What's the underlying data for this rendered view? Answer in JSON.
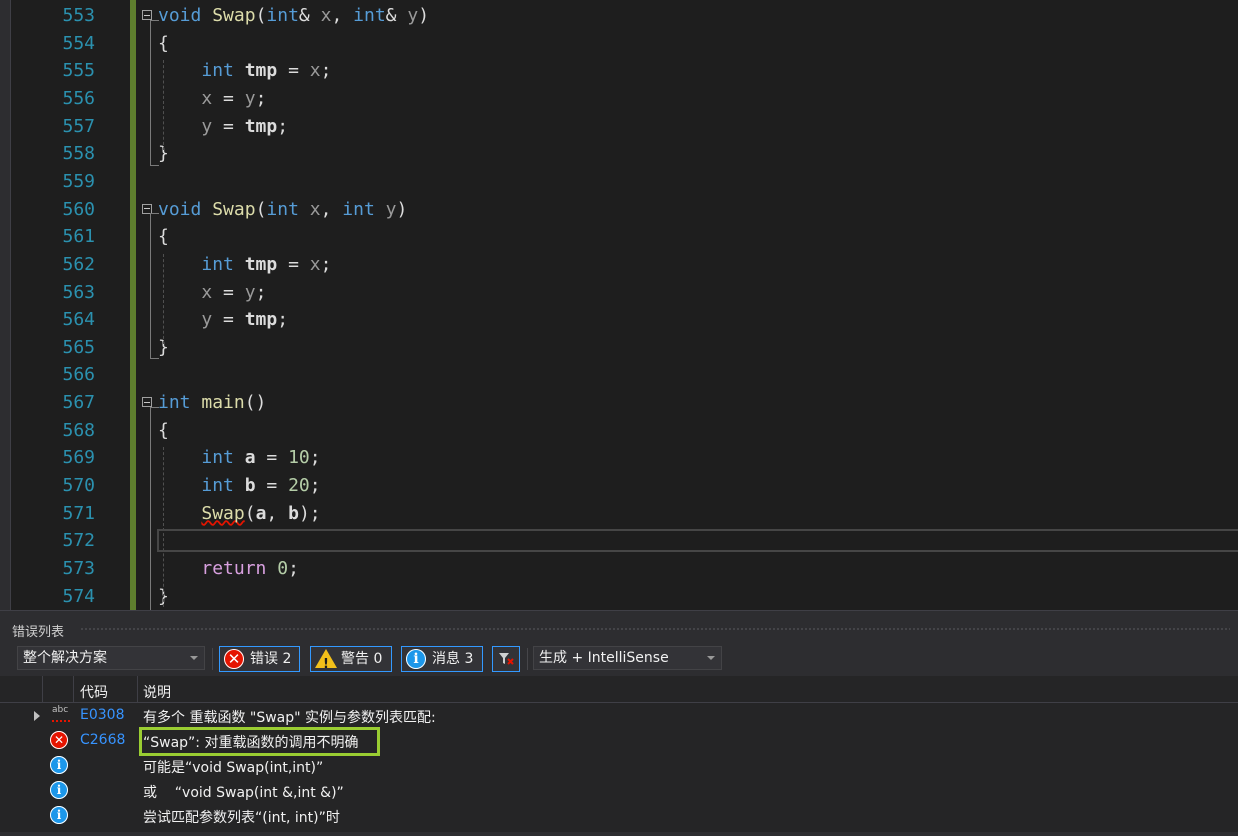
{
  "editor": {
    "lines": [
      {
        "n": "553",
        "fold": true,
        "parts": [
          [
            "k",
            "void"
          ],
          [
            "t",
            " "
          ],
          [
            "f",
            "Swap"
          ],
          [
            "t",
            "("
          ],
          [
            "k",
            "int"
          ],
          [
            "t",
            "& "
          ],
          [
            "p",
            "x"
          ],
          [
            "t",
            ", "
          ],
          [
            "k",
            "int"
          ],
          [
            "t",
            "& "
          ],
          [
            "p",
            "y"
          ],
          [
            "t",
            ")"
          ]
        ]
      },
      {
        "n": "554",
        "fold": false,
        "parts": [
          [
            "t",
            "{"
          ]
        ]
      },
      {
        "n": "555",
        "fold": false,
        "parts": [
          [
            "t",
            "    "
          ],
          [
            "k",
            "int"
          ],
          [
            "t",
            " "
          ],
          [
            "l",
            "tmp"
          ],
          [
            "t",
            " = "
          ],
          [
            "p",
            "x"
          ],
          [
            "t",
            ";"
          ]
        ]
      },
      {
        "n": "556",
        "fold": false,
        "parts": [
          [
            "t",
            "    "
          ],
          [
            "p",
            "x"
          ],
          [
            "t",
            " = "
          ],
          [
            "p",
            "y"
          ],
          [
            "t",
            ";"
          ]
        ]
      },
      {
        "n": "557",
        "fold": false,
        "parts": [
          [
            "t",
            "    "
          ],
          [
            "p",
            "y"
          ],
          [
            "t",
            " = "
          ],
          [
            "l",
            "tmp"
          ],
          [
            "t",
            ";"
          ]
        ]
      },
      {
        "n": "558",
        "fold": false,
        "parts": [
          [
            "t",
            "}"
          ]
        ]
      },
      {
        "n": "559",
        "fold": false,
        "parts": []
      },
      {
        "n": "560",
        "fold": true,
        "parts": [
          [
            "k",
            "void"
          ],
          [
            "t",
            " "
          ],
          [
            "f",
            "Swap"
          ],
          [
            "t",
            "("
          ],
          [
            "k",
            "int"
          ],
          [
            "t",
            " "
          ],
          [
            "p",
            "x"
          ],
          [
            "t",
            ", "
          ],
          [
            "k",
            "int"
          ],
          [
            "t",
            " "
          ],
          [
            "p",
            "y"
          ],
          [
            "t",
            ")"
          ]
        ]
      },
      {
        "n": "561",
        "fold": false,
        "parts": [
          [
            "t",
            "{"
          ]
        ]
      },
      {
        "n": "562",
        "fold": false,
        "parts": [
          [
            "t",
            "    "
          ],
          [
            "k",
            "int"
          ],
          [
            "t",
            " "
          ],
          [
            "l",
            "tmp"
          ],
          [
            "t",
            " = "
          ],
          [
            "p",
            "x"
          ],
          [
            "t",
            ";"
          ]
        ]
      },
      {
        "n": "563",
        "fold": false,
        "parts": [
          [
            "t",
            "    "
          ],
          [
            "p",
            "x"
          ],
          [
            "t",
            " = "
          ],
          [
            "p",
            "y"
          ],
          [
            "t",
            ";"
          ]
        ]
      },
      {
        "n": "564",
        "fold": false,
        "parts": [
          [
            "t",
            "    "
          ],
          [
            "p",
            "y"
          ],
          [
            "t",
            " = "
          ],
          [
            "l",
            "tmp"
          ],
          [
            "t",
            ";"
          ]
        ]
      },
      {
        "n": "565",
        "fold": false,
        "parts": [
          [
            "t",
            "}"
          ]
        ]
      },
      {
        "n": "566",
        "fold": false,
        "parts": []
      },
      {
        "n": "567",
        "fold": true,
        "parts": [
          [
            "k",
            "int"
          ],
          [
            "t",
            " "
          ],
          [
            "f",
            "main"
          ],
          [
            "t",
            "()"
          ]
        ]
      },
      {
        "n": "568",
        "fold": false,
        "parts": [
          [
            "t",
            "{"
          ]
        ]
      },
      {
        "n": "569",
        "fold": false,
        "parts": [
          [
            "t",
            "    "
          ],
          [
            "k",
            "int"
          ],
          [
            "t",
            " "
          ],
          [
            "l",
            "a"
          ],
          [
            "t",
            " = "
          ],
          [
            "n",
            "10"
          ],
          [
            "t",
            ";"
          ]
        ]
      },
      {
        "n": "570",
        "fold": false,
        "parts": [
          [
            "t",
            "    "
          ],
          [
            "k",
            "int"
          ],
          [
            "t",
            " "
          ],
          [
            "l",
            "b"
          ],
          [
            "t",
            " = "
          ],
          [
            "n",
            "20"
          ],
          [
            "t",
            ";"
          ]
        ]
      },
      {
        "n": "571",
        "fold": false,
        "parts": [
          [
            "t",
            "    "
          ],
          [
            "fs",
            "Swap"
          ],
          [
            "t",
            "("
          ],
          [
            "l",
            "a"
          ],
          [
            "t",
            ", "
          ],
          [
            "l",
            "b"
          ],
          [
            "t",
            ");"
          ]
        ]
      },
      {
        "n": "572",
        "fold": false,
        "parts": []
      },
      {
        "n": "573",
        "fold": false,
        "parts": [
          [
            "t",
            "    "
          ],
          [
            "ctl",
            "return"
          ],
          [
            "t",
            " "
          ],
          [
            "n",
            "0"
          ],
          [
            "t",
            ";"
          ]
        ]
      },
      {
        "n": "574",
        "fold": false,
        "parts": [
          [
            "t",
            "}"
          ]
        ]
      }
    ]
  },
  "error_list": {
    "title": "错误列表",
    "scope_combo": "整个解决方案",
    "errors_label": "错误 2",
    "warnings_label": "警告 0",
    "messages_label": "消息 3",
    "build_combo": "生成 + IntelliSense",
    "columns": {
      "code": "代码",
      "description": "说明"
    },
    "rows": [
      {
        "icon": "intellisense",
        "code": "E0308",
        "desc": "有多个 重载函数 \"Swap\" 实例与参数列表匹配:"
      },
      {
        "icon": "error",
        "code": "C2668",
        "desc": "“Swap”: 对重载函数的调用不明确"
      },
      {
        "icon": "info",
        "code": "",
        "desc": "可能是“void Swap(int,int)”"
      },
      {
        "icon": "info",
        "code": "",
        "desc": "或    “void Swap(int &,int &)”"
      },
      {
        "icon": "info",
        "code": "",
        "desc": "尝试匹配参数列表“(int, int)”时"
      }
    ]
  },
  "colors": {
    "keyword": "#569cd6",
    "function": "#dcdcaa",
    "number": "#b5cea8",
    "line_number": "#2b91af",
    "error": "#e51400",
    "info": "#1c97ea",
    "highlight": "#9acd32"
  }
}
